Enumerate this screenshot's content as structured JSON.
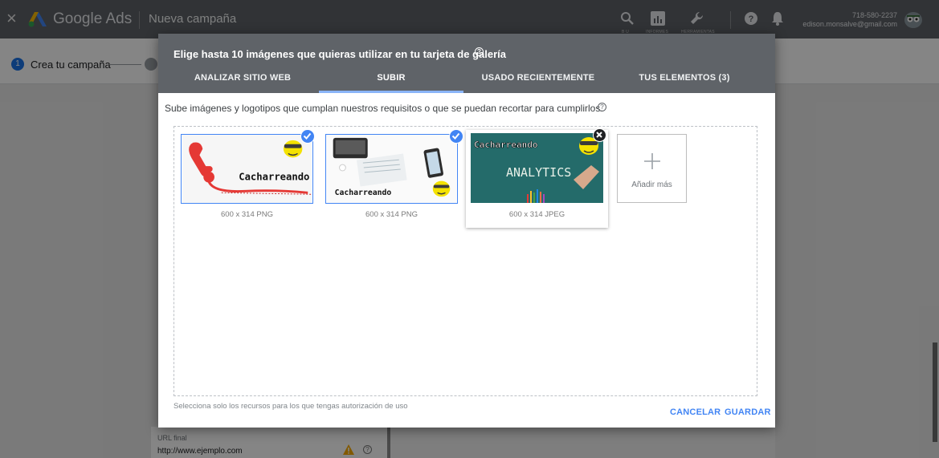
{
  "app": {
    "close_glyph": "×",
    "brand": "Google Ads",
    "campaign_title": "Nueva campaña",
    "toolbar_captions": {
      "search": "B U",
      "reports": "INFORMES",
      "tools": "HERRAMIENTAS"
    },
    "account_phone": "718-580-2237",
    "account_email": "edison.monsalve@gmail.com"
  },
  "stepper": {
    "step1_number": "1",
    "step1_label": "Crea tu campaña"
  },
  "form": {
    "url_label": "URL final",
    "url_placeholder": "http://www.ejemplo.com"
  },
  "dialog": {
    "title": "Elige hasta 10 imágenes que quieras utilizar en tu tarjeta de galería",
    "tabs": [
      "ANALIZAR SITIO WEB",
      "SUBIR",
      "USADO RECIENTEMENTE",
      "TUS ELEMENTOS (3)"
    ],
    "active_tab": "SUBIR",
    "instructions": "Sube imágenes y logotipos que cumplan nuestros requisitos o que se puedan recortar para cumplirlos.",
    "images": [
      {
        "caption": "600 x 314 PNG",
        "selected": true,
        "image_text": "Cacharreando"
      },
      {
        "caption": "600 x 314 PNG",
        "selected": true,
        "image_text": "Cacharreando"
      },
      {
        "caption": "600 x 314 JPEG",
        "selected": false,
        "image_text": "Cacharreando",
        "image_text2": "ANALYTICS"
      }
    ],
    "add_more_label": "Añadir más",
    "footnote": "Selecciona solo los recursos para los que tengas autorización de uso",
    "cancel_label": "CANCELAR",
    "save_label": "GUARDAR"
  },
  "colors": {
    "header_gray": "#5f6368",
    "accent_blue": "#4285f4",
    "tab_indicator": "#8ab4f8"
  }
}
